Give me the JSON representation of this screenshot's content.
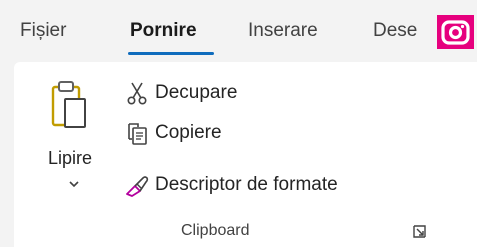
{
  "tabs": [
    {
      "label": "Fișier"
    },
    {
      "label": "Pornire",
      "active": true
    },
    {
      "label": "Inserare"
    },
    {
      "label": "Dese"
    }
  ],
  "clipboard": {
    "paste_label": "Lipire",
    "commands": [
      {
        "label": "Decupare",
        "icon": "scissors-icon"
      },
      {
        "label": "Copiere",
        "icon": "copy-icon"
      },
      {
        "label": "Descriptor de formate",
        "icon": "format-painter-icon"
      }
    ],
    "group_label": "Clipboard",
    "launcher_icon": "dialog-launcher-icon"
  },
  "badge": {
    "icon": "camera-icon",
    "color": "#e6007e"
  },
  "colors": {
    "accent": "#0f6cbd",
    "format_painter": "#b4009e",
    "paste_clipboard": "#c19c00"
  }
}
